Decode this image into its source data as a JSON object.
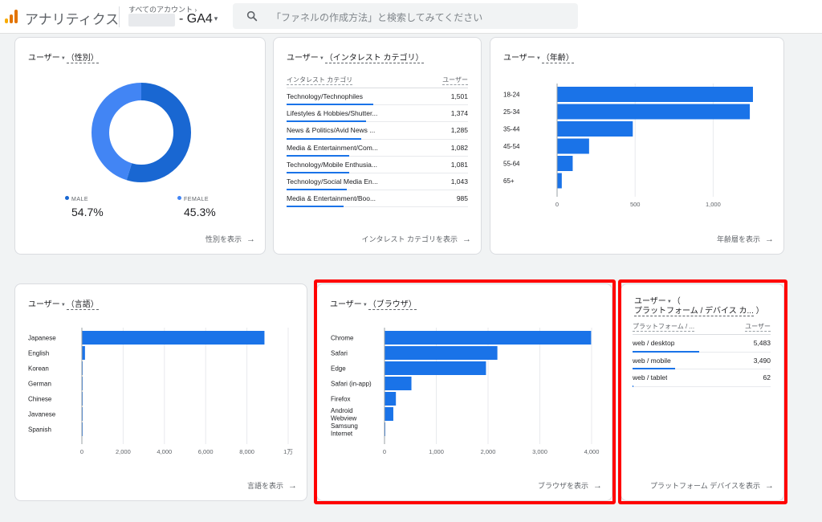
{
  "header": {
    "app_title": "アナリティクス",
    "account_label": "すべてのアカウント",
    "account_chevron": "›",
    "property_name": "- GA4",
    "property_caret": "▾",
    "search_placeholder": "「ファネルの作成方法」と検索してみてください"
  },
  "colors": {
    "accent": "#1a73e8",
    "donut_light": "#4285f4",
    "donut_dark": "#1967d2",
    "highlight": "#ff0000",
    "logo": [
      "#f9ab00",
      "#e37400",
      "#e37400"
    ]
  },
  "gender_card": {
    "title_metric": "ユーザー",
    "title_dim": "（性別）",
    "footer": "性別を表示",
    "chart_data": {
      "type": "pie",
      "title": "",
      "slices": [
        {
          "name": "MALE",
          "value": 54.7,
          "display": "54.7%"
        },
        {
          "name": "FEMALE",
          "value": 45.3,
          "display": "45.3%"
        }
      ]
    }
  },
  "interest_card": {
    "title_metric": "ユーザー",
    "title_dim": "（インタレスト カテゴリ）",
    "col_dim": "インタレスト カテゴリ",
    "col_metric": "ユーザー",
    "footer": "インタレスト カテゴリを表示",
    "rows": [
      {
        "label": "Technology/Technophiles",
        "value": 1501,
        "display": "1,501"
      },
      {
        "label": "Lifestyles & Hobbies/Shutter...",
        "value": 1374,
        "display": "1,374"
      },
      {
        "label": "News & Politics/Avid News ...",
        "value": 1285,
        "display": "1,285"
      },
      {
        "label": "Media & Entertainment/Com...",
        "value": 1082,
        "display": "1,082"
      },
      {
        "label": "Technology/Mobile Enthusia...",
        "value": 1081,
        "display": "1,081"
      },
      {
        "label": "Technology/Social Media En...",
        "value": 1043,
        "display": "1,043"
      },
      {
        "label": "Media & Entertainment/Boo...",
        "value": 985,
        "display": "985"
      }
    ]
  },
  "age_card": {
    "title_metric": "ユーザー",
    "title_dim": "（年齢）",
    "footer": "年齢層を表示",
    "chart_data": {
      "type": "bar",
      "orientation": "horizontal",
      "categories": [
        "18-24",
        "25-34",
        "35-44",
        "45-54",
        "55-64",
        "65+"
      ],
      "values": [
        1255,
        1235,
        485,
        205,
        100,
        30
      ],
      "xlim": [
        0,
        1250
      ],
      "ticks": [
        0,
        500,
        1000
      ],
      "tick_labels": [
        "0",
        "500",
        "1,000"
      ],
      "grid": true
    }
  },
  "language_card": {
    "title_metric": "ユーザー",
    "title_dim": "（言語）",
    "footer": "言語を表示",
    "chart_data": {
      "type": "bar",
      "orientation": "horizontal",
      "categories": [
        "Japanese",
        "English",
        "Korean",
        "German",
        "Chinese",
        "Javanese",
        "Spanish"
      ],
      "values": [
        8850,
        150,
        15,
        12,
        10,
        8,
        6
      ],
      "xlim": [
        0,
        10000
      ],
      "ticks": [
        0,
        2000,
        4000,
        6000,
        8000,
        10000
      ],
      "tick_labels": [
        "0",
        "2,000",
        "4,000",
        "6,000",
        "8,000",
        "1万"
      ],
      "grid": true
    }
  },
  "browser_card": {
    "title_metric": "ユーザー",
    "title_dim": "（ブラウザ）",
    "footer": "ブラウザを表示",
    "chart_data": {
      "type": "bar",
      "orientation": "horizontal",
      "categories": [
        "Chrome",
        "Safari",
        "Edge",
        "Safari (in-app)",
        "Firefox",
        "Android Webview",
        "Samsung Internet"
      ],
      "values": [
        3990,
        2180,
        1960,
        520,
        220,
        170,
        15
      ],
      "xlim": [
        0,
        4000
      ],
      "ticks": [
        0,
        1000,
        2000,
        3000,
        4000
      ],
      "tick_labels": [
        "0",
        "1,000",
        "2,000",
        "3,000",
        "4,000"
      ],
      "grid": true
    }
  },
  "platform_card": {
    "title_metric": "ユーザー",
    "title_paren": "（",
    "title_dim": "プラットフォーム / デバイス カ...",
    "title_close": "）",
    "col_dim": "プラットフォーム / ...",
    "col_metric": "ユーザー",
    "footer": "プラットフォーム デバイスを表示",
    "rows": [
      {
        "label": "web / desktop",
        "value": 5483,
        "display": "5,483"
      },
      {
        "label": "web / mobile",
        "value": 3490,
        "display": "3,490"
      },
      {
        "label": "web / tablet",
        "value": 62,
        "display": "62"
      }
    ]
  }
}
